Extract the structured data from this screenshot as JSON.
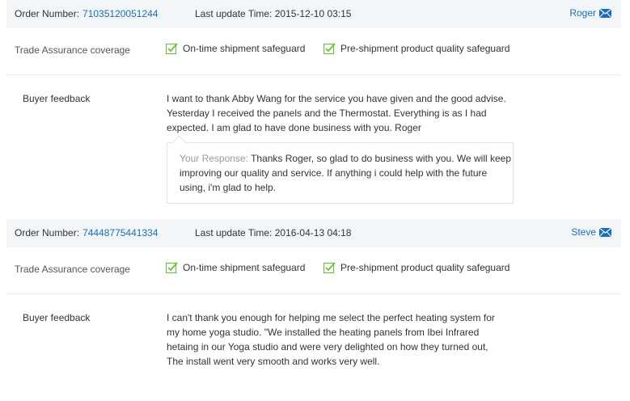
{
  "orders": [
    {
      "order_number_label": "Order Number:",
      "order_number": "71035120051244",
      "last_update_label": "Last update Time:",
      "last_update": "2015-12-10 03:15",
      "user": "Roger",
      "coverage_label": "Trade Assurance coverage",
      "coverage_items": [
        "On-time shipment safeguard",
        "Pre-shipment product quality safeguard"
      ],
      "feedback_label": "Buyer feedback",
      "feedback": "I want to thank Abby Wang for the service you have given and the good advise. Yesterday I received the panels and the Thermostat. Everything is as I had expected. I am glad to have done business with you. Roger",
      "response_label": "Your Response:",
      "response": " Thanks Roger, so glad to do business with you. We will keep improving our quality and service. If anything i could help with the future using, i'm glad to help."
    },
    {
      "order_number_label": "Order Number:",
      "order_number": "74448775441334",
      "last_update_label": "Last update Time:",
      "last_update": "2016-04-13 04:18",
      "user": "Steve",
      "coverage_label": "Trade Assurance coverage",
      "coverage_items": [
        "On-time shipment safeguard",
        "Pre-shipment product quality safeguard"
      ],
      "feedback_label": "Buyer feedback",
      "feedback": "I can't thank you enough for helping me select the perfect heating system for my home yoga studio. \"We installed the heating panels from Ibei Infrared hetaing in our Yoga studio and were very delighted on how they turned out, The install went very smooth and works very well."
    }
  ],
  "colors": {
    "link": "#1a6dbb",
    "check": "#6cbf3f",
    "header_bg": "#f3f6f9"
  },
  "icons": {
    "user_mail": "mail-icon",
    "coverage": "checkbox-checked-icon"
  }
}
